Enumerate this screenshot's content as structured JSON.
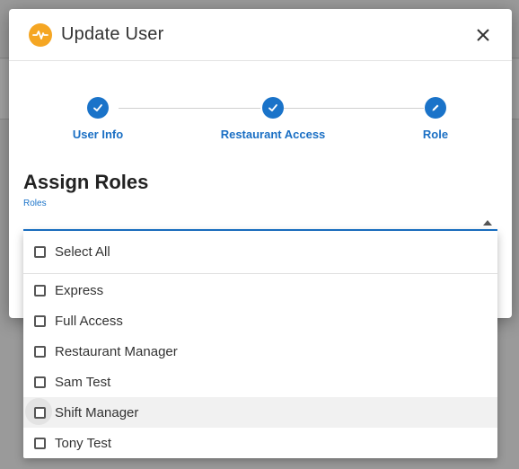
{
  "dialog": {
    "title": "Update User",
    "close_label": "×"
  },
  "stepper": {
    "steps": [
      {
        "label": "User Info",
        "state": "completed",
        "icon": "check-icon"
      },
      {
        "label": "Restaurant Access",
        "state": "completed",
        "icon": "check-icon"
      },
      {
        "label": "Role",
        "state": "active",
        "icon": "pencil-icon"
      }
    ]
  },
  "section": {
    "title": "Assign Roles"
  },
  "roles_field": {
    "label": "Roles",
    "value": ""
  },
  "dropdown": {
    "select_all_label": "Select All",
    "options": [
      {
        "label": "Express",
        "checked": false
      },
      {
        "label": "Full Access",
        "checked": false
      },
      {
        "label": "Restaurant Manager",
        "checked": false
      },
      {
        "label": "Sam Test",
        "checked": false
      },
      {
        "label": "Shift Manager",
        "checked": false,
        "hovered": true
      },
      {
        "label": "Tony Test",
        "checked": false
      }
    ]
  },
  "colors": {
    "primary": "#1a73c9",
    "logo": "#f5a623"
  }
}
